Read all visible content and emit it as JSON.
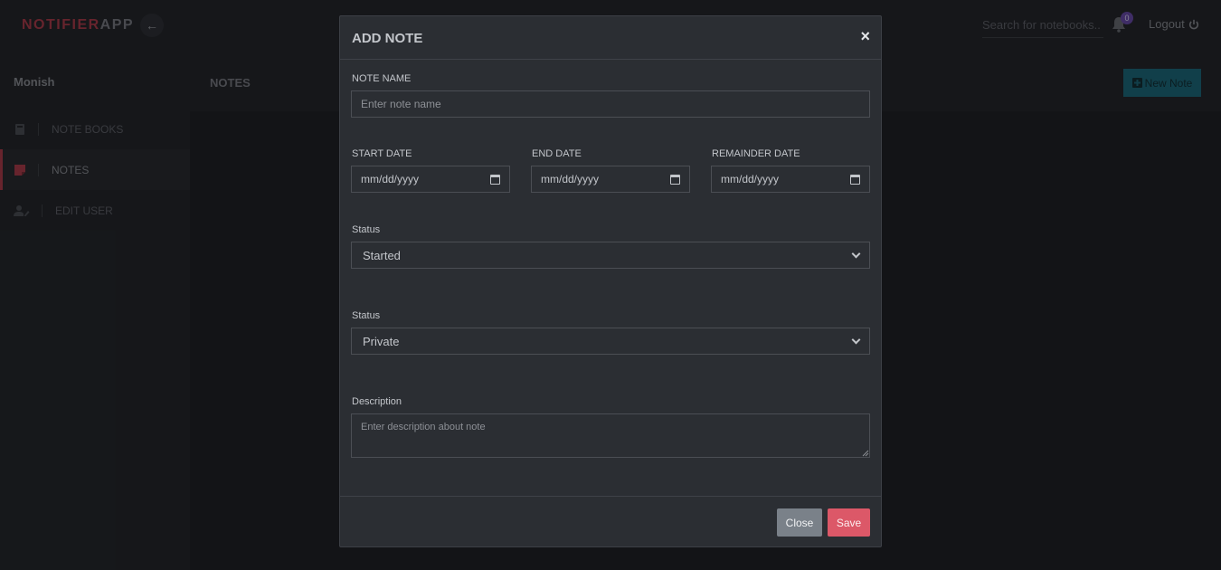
{
  "app": {
    "brand_part1": "NOTIFIER",
    "brand_part2": "APP",
    "search_placeholder": "Search for notebooks..",
    "notification_count": "0",
    "logout_label": "Logout"
  },
  "sidebar": {
    "user_name": "Monish",
    "items": [
      {
        "label": "NOTE BOOKS",
        "icon": "notebook-icon",
        "active": false
      },
      {
        "label": "NOTES",
        "icon": "sticky-note-icon",
        "active": true
      },
      {
        "label": "EDIT USER",
        "icon": "user-edit-icon",
        "active": false
      }
    ]
  },
  "content": {
    "title": "NOTES",
    "new_note_label": "New Note"
  },
  "modal": {
    "title": "ADD NOTE",
    "note_name_label": "NOTE NAME",
    "note_name_placeholder": "Enter note name",
    "start_date_label": "START DATE",
    "end_date_label": "END DATE",
    "remainder_date_label": "REMAINDER DATE",
    "date_placeholder": "mm/dd/yyyy",
    "status_label": "Status",
    "status_value": "Started",
    "visibility_label": "Status",
    "visibility_value": "Private",
    "description_label": "Description",
    "description_placeholder": "Enter description about note",
    "close_label": "Close",
    "save_label": "Save"
  },
  "colors": {
    "brand_accent": "#b33a48",
    "primary_button": "#176b7c",
    "save_button": "#dc5868",
    "close_button": "#7a8189",
    "badge": "#6a4ab0"
  }
}
